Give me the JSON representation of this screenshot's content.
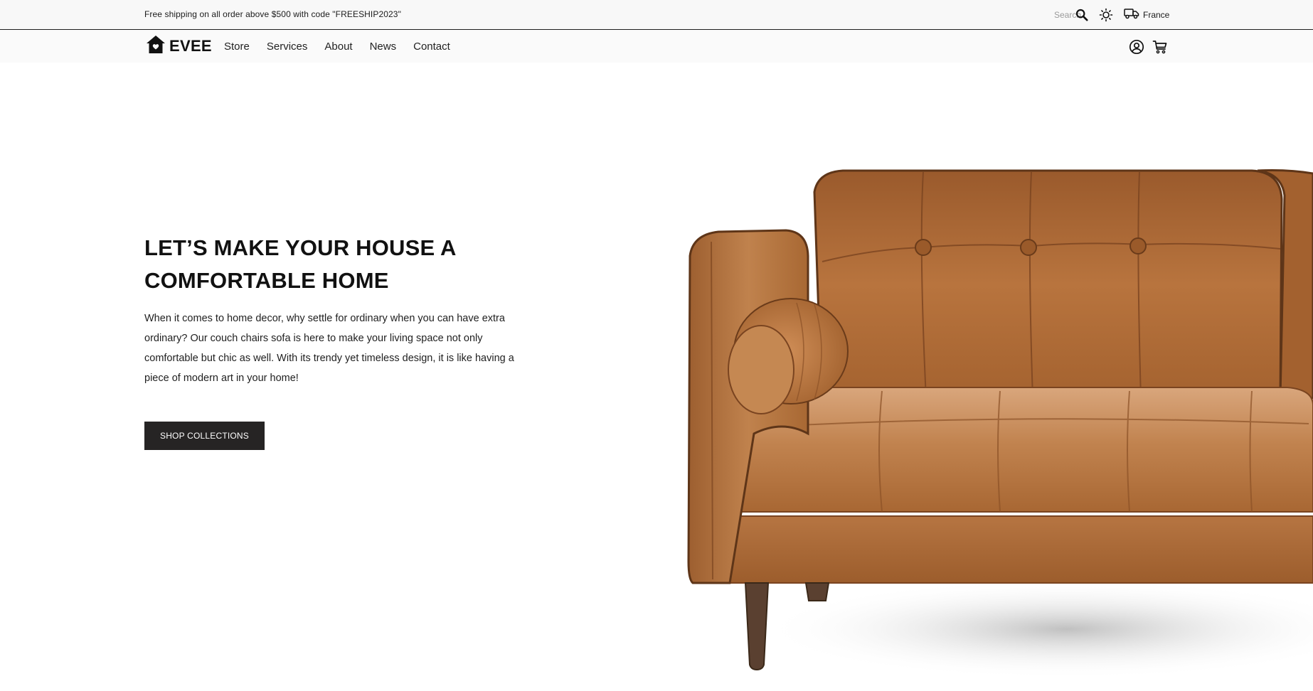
{
  "announcement": {
    "text": "Free shipping on all order above $500 with code \"FREESHIP2023\""
  },
  "utility": {
    "search_placeholder": "Search",
    "search_icon": "search-icon",
    "theme_icon": "sun-icon",
    "shipping_icon": "truck-icon",
    "region": "France"
  },
  "header": {
    "logo_icon": "house-icon",
    "logo_text": "EVEE",
    "nav": [
      {
        "label": "Store"
      },
      {
        "label": "Services"
      },
      {
        "label": "About"
      },
      {
        "label": "News"
      },
      {
        "label": "Contact"
      }
    ],
    "account_icon": "user-circle-icon",
    "cart_icon": "cart-icon"
  },
  "hero": {
    "title_line1": "LET’S MAKE YOUR HOUSE A",
    "title_line2": "COMFORTABLE HOME",
    "description": "When it comes to home decor, why settle for ordinary when you can have extra ordinary? Our couch chairs sofa is here to make your living space not only comfortable but chic as well. With its trendy yet timeless design, it is like having a piece of modern art in your home!",
    "cta_label": "SHOP COLLECTIONS",
    "image_subject": "tan-leather-sofa-image"
  },
  "colors": {
    "announcement_bg": "#f8f8f8",
    "header_bg": "#fafafa",
    "cta_bg": "#262424",
    "cta_text": "#ffffff",
    "sofa_leather": "#b06a35",
    "sofa_legs": "#5a4030"
  }
}
